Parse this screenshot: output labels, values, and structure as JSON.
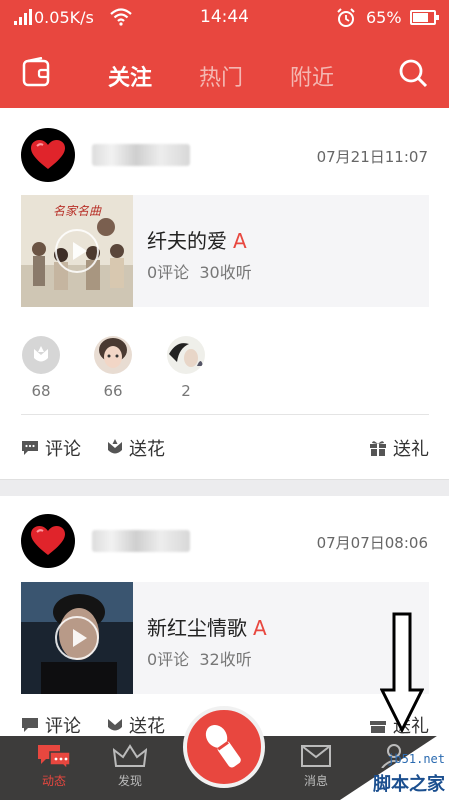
{
  "status_bar": {
    "network_speed": "0.05K/s",
    "time": "14:44",
    "battery_percent": "65%"
  },
  "nav": {
    "tabs": [
      "关注",
      "热门",
      "附近"
    ],
    "active_tab": "关注"
  },
  "feed": [
    {
      "datetime": "07月21日11:07",
      "song_title": "纤夫的爱",
      "grade": "A",
      "comments": "0评论",
      "listens": "30收听",
      "cover_caption": "名家名曲",
      "flower_givers": [
        {
          "count": "68"
        },
        {
          "count": "66"
        },
        {
          "count": "2"
        }
      ],
      "actions": {
        "comment": "评论",
        "flower": "送花",
        "gift": "送礼"
      }
    },
    {
      "datetime": "07月07日08:06",
      "song_title": "新红尘情歌",
      "grade": "A",
      "comments": "0评论",
      "listens": "32收听",
      "actions": {
        "comment": "评论",
        "flower": "送花",
        "gift": "送礼"
      }
    }
  ],
  "tab_bar": {
    "items": [
      "动态",
      "发现",
      "消息",
      "我的"
    ],
    "active": "动态"
  },
  "watermark": {
    "url": "jb51.net",
    "text": "脚本之家"
  },
  "colors": {
    "brand_red": "#e8473f",
    "tabbar_dark": "#3d3c3b"
  }
}
